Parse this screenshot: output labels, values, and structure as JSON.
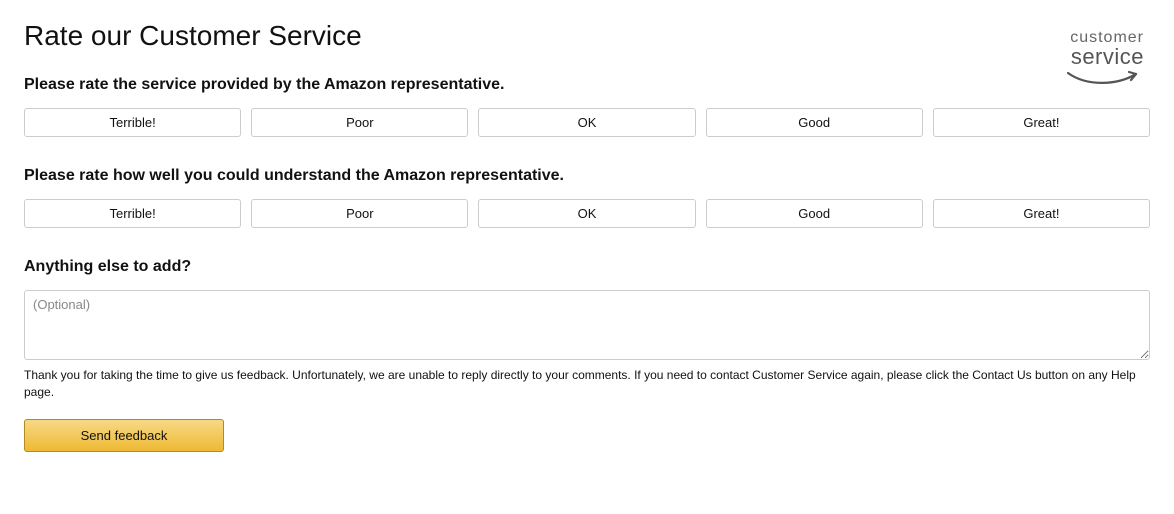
{
  "header": {
    "title": "Rate our Customer Service",
    "logo_line1": "customer",
    "logo_line2": "service"
  },
  "q1": {
    "prompt": "Please rate the service provided by the Amazon representative.",
    "options": [
      "Terrible!",
      "Poor",
      "OK",
      "Good",
      "Great!"
    ]
  },
  "q2": {
    "prompt": "Please rate how well you could understand the Amazon representative.",
    "options": [
      "Terrible!",
      "Poor",
      "OK",
      "Good",
      "Great!"
    ]
  },
  "comments": {
    "prompt": "Anything else to add?",
    "placeholder": "(Optional)"
  },
  "disclaimer": "Thank you for taking the time to give us feedback. Unfortunately, we are unable to reply directly to your comments. If you need to contact Customer Service again, please click the Contact Us button on any Help page.",
  "submit_label": "Send feedback"
}
